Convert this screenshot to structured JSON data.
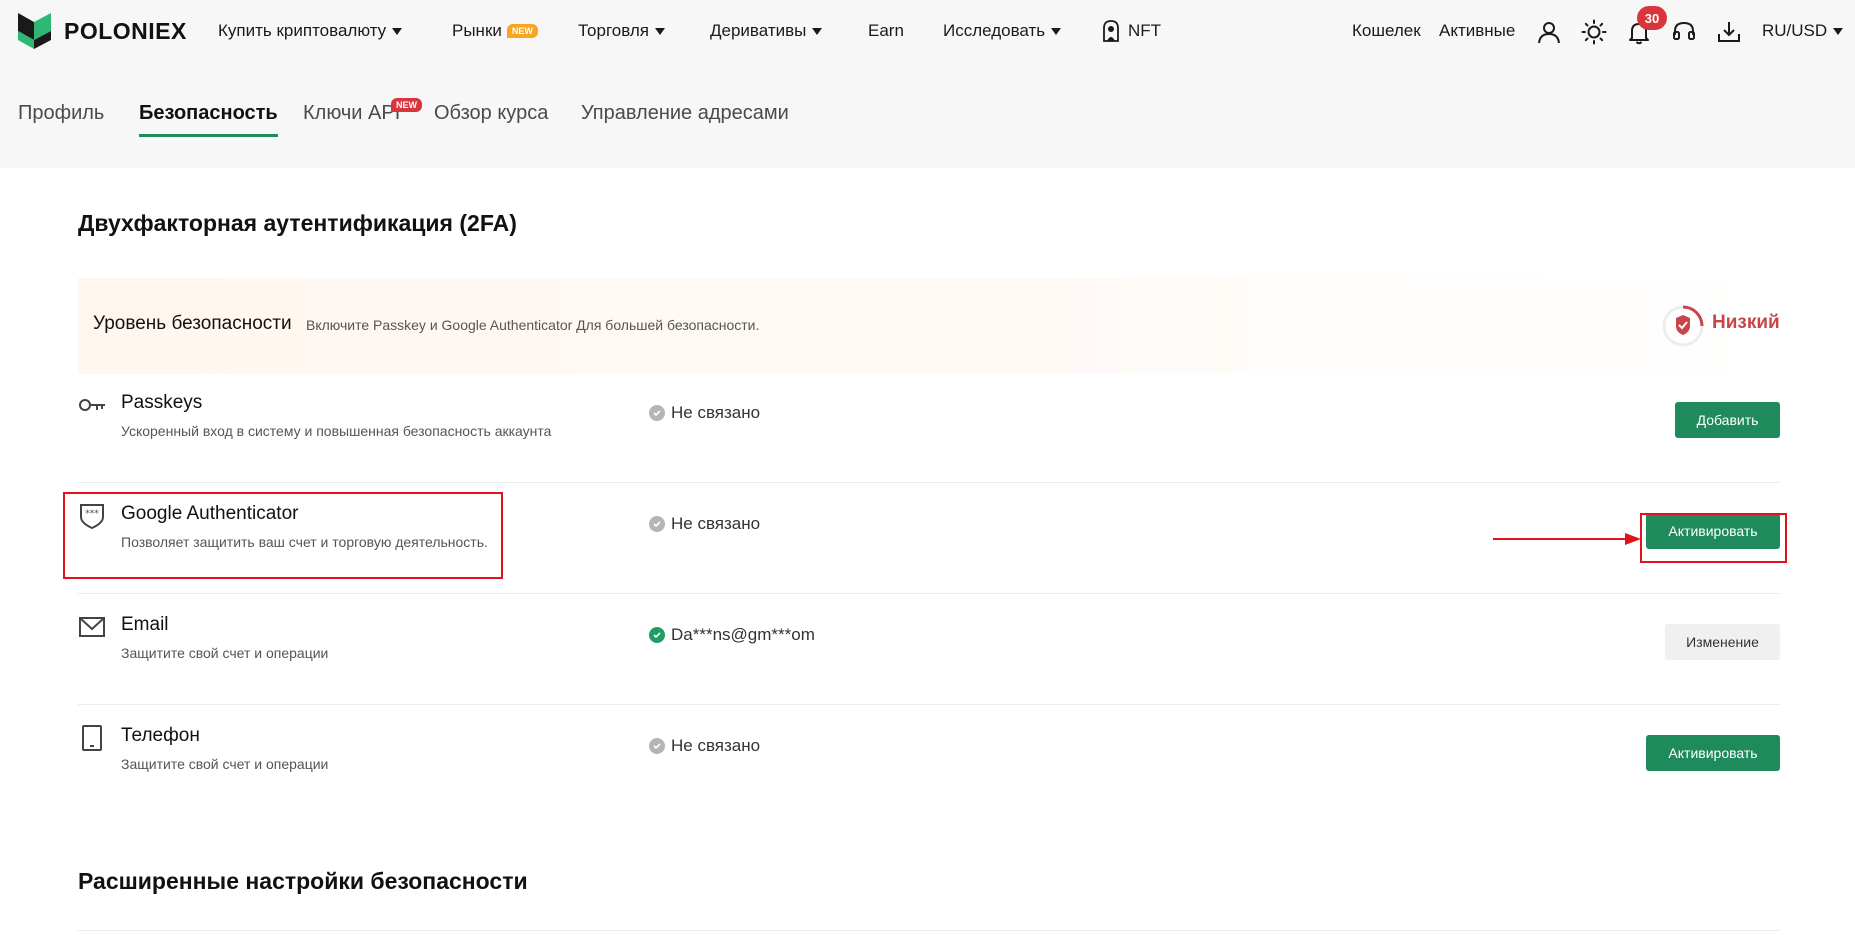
{
  "header": {
    "brand": "POLONIEX",
    "nav": [
      {
        "label": "Купить криптовалюту",
        "dropdown": true
      },
      {
        "label": "Рынки",
        "badge": "NEW"
      },
      {
        "label": "Торговля",
        "dropdown": true
      },
      {
        "label": "Деривативы",
        "dropdown": true
      },
      {
        "label": "Earn"
      },
      {
        "label": "Исследовать",
        "dropdown": true
      },
      {
        "label": "NFT"
      }
    ],
    "wallet": "Кошелек",
    "assets": "Активные",
    "notifications_count": "30",
    "locale": "RU/USD",
    "icons": [
      "user-icon",
      "sun-icon",
      "bell-icon",
      "headset-icon",
      "download-icon"
    ]
  },
  "tabs": [
    {
      "label": "Профиль"
    },
    {
      "label": "Безопасность",
      "active": true
    },
    {
      "label": "Ключи API",
      "badge": "NEW"
    },
    {
      "label": "Обзор курса"
    },
    {
      "label": "Управление адресами"
    }
  ],
  "twofa": {
    "title": "Двухфакторная аутентификация (2FA)",
    "level": {
      "title": "Уровень безопасности",
      "description": "Включите Passkey и Google Authenticator Для большей безопасности.",
      "value": "Низкий"
    },
    "rows": [
      {
        "title": "Passkeys",
        "description": "Ускоренный вход в систему и повышенная безопасность аккаунта",
        "status": "Не связано",
        "button": "Добавить",
        "icon": "key-icon"
      },
      {
        "title": "Google Authenticator",
        "description": "Позволяет защитить ваш счет и торговую деятельность.",
        "status": "Не связано",
        "button": "Активировать",
        "icon": "authenticator-shield-icon"
      },
      {
        "title": "Email",
        "description": "Защитите свой счет и операции",
        "status": "Da***ns@gm***om",
        "button": "Изменение",
        "icon": "mail-icon"
      },
      {
        "title": "Телефон",
        "description": "Защитите свой счет и операции",
        "status": "Не связано",
        "button": "Активировать",
        "icon": "phone-icon"
      }
    ]
  },
  "advanced": {
    "title": "Расширенные настройки безопасности"
  },
  "colors": {
    "accent": "#1f8a5b",
    "danger": "#c9454a",
    "annotation": "#e0121b"
  }
}
